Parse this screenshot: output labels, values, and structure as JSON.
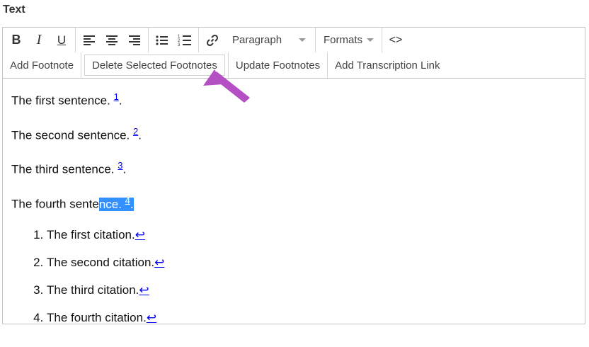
{
  "field": {
    "label": "Text"
  },
  "toolbar": {
    "bold": "B",
    "italic": "I",
    "underline": "U",
    "paragraph": "Paragraph",
    "formats": "Formats",
    "code": "<>",
    "row2": {
      "add_footnote": "Add Footnote",
      "delete_selected": "Delete Selected Footnotes",
      "update_footnotes": "Update Footnotes",
      "add_transcription_link": "Add Transcription Link"
    }
  },
  "content": {
    "sentences": [
      {
        "text": "The first sentence. ",
        "ref": "1",
        "after": "."
      },
      {
        "text": "The second sentence. ",
        "ref": "2",
        "after": "."
      },
      {
        "text": "The third sentence. ",
        "ref": "3",
        "after": "."
      }
    ],
    "fourth": {
      "text_before": "The fourth sente",
      "text_selected": "nce. ",
      "ref": "4",
      "after": "."
    },
    "citations": [
      {
        "text": "The first citation.",
        "back": "↩"
      },
      {
        "text": "The second citation.",
        "back": "↩"
      },
      {
        "text": "The third citation.",
        "back": "↩"
      },
      {
        "text": "The fourth citation.",
        "back": "↩"
      }
    ]
  },
  "colors": {
    "selection": "#3390ff",
    "link": "#0000ee",
    "arrow": "#b44fc4"
  }
}
